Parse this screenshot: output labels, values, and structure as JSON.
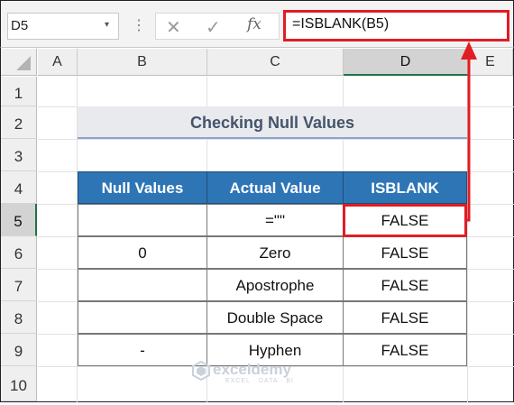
{
  "formula_bar": {
    "name_box": "D5",
    "name_box_arrow": "▾",
    "dots": "⋮",
    "cancel_icon": "✕",
    "enter_icon": "✓",
    "fx_label": "fx",
    "formula": "=ISBLANK(B5)"
  },
  "columns": [
    "A",
    "B",
    "C",
    "D",
    "E"
  ],
  "selected_column": "D",
  "rows": [
    "1",
    "2",
    "3",
    "4",
    "5",
    "6",
    "7",
    "8",
    "9",
    "10"
  ],
  "selected_row": "5",
  "title": "Checking Null Values",
  "table": {
    "headers": [
      "Null Values",
      "Actual Value",
      "ISBLANK"
    ],
    "rows": [
      [
        "",
        "=\"\"",
        "FALSE"
      ],
      [
        "0",
        "Zero",
        "FALSE"
      ],
      [
        "",
        "Apostrophe",
        "FALSE"
      ],
      [
        "",
        "Double Space",
        "FALSE"
      ],
      [
        "-",
        "Hyphen",
        "FALSE"
      ]
    ]
  },
  "watermark": {
    "name": "exceldemy",
    "tagline": "EXCEL · DATA · BI"
  },
  "colors": {
    "header_fill": "#2e75b6",
    "highlight": "#e01d24",
    "title_text": "#44546a",
    "select_green": "#217346"
  }
}
